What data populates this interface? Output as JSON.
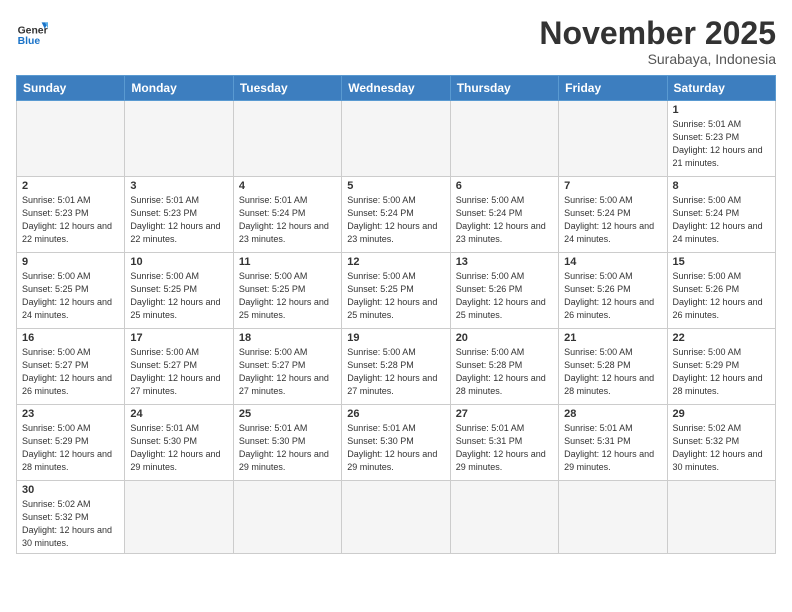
{
  "logo": {
    "text_general": "General",
    "text_blue": "Blue"
  },
  "header": {
    "month": "November 2025",
    "location": "Surabaya, Indonesia"
  },
  "weekdays": [
    "Sunday",
    "Monday",
    "Tuesday",
    "Wednesday",
    "Thursday",
    "Friday",
    "Saturday"
  ],
  "weeks": [
    [
      {
        "day": "",
        "empty": true
      },
      {
        "day": "",
        "empty": true
      },
      {
        "day": "",
        "empty": true
      },
      {
        "day": "",
        "empty": true
      },
      {
        "day": "",
        "empty": true
      },
      {
        "day": "",
        "empty": true
      },
      {
        "day": "1",
        "sunrise": "5:01 AM",
        "sunset": "5:23 PM",
        "daylight": "12 hours and 21 minutes."
      }
    ],
    [
      {
        "day": "2",
        "sunrise": "5:01 AM",
        "sunset": "5:23 PM",
        "daylight": "12 hours and 22 minutes."
      },
      {
        "day": "3",
        "sunrise": "5:01 AM",
        "sunset": "5:23 PM",
        "daylight": "12 hours and 22 minutes."
      },
      {
        "day": "4",
        "sunrise": "5:01 AM",
        "sunset": "5:24 PM",
        "daylight": "12 hours and 23 minutes."
      },
      {
        "day": "5",
        "sunrise": "5:00 AM",
        "sunset": "5:24 PM",
        "daylight": "12 hours and 23 minutes."
      },
      {
        "day": "6",
        "sunrise": "5:00 AM",
        "sunset": "5:24 PM",
        "daylight": "12 hours and 23 minutes."
      },
      {
        "day": "7",
        "sunrise": "5:00 AM",
        "sunset": "5:24 PM",
        "daylight": "12 hours and 24 minutes."
      },
      {
        "day": "8",
        "sunrise": "5:00 AM",
        "sunset": "5:24 PM",
        "daylight": "12 hours and 24 minutes."
      }
    ],
    [
      {
        "day": "9",
        "sunrise": "5:00 AM",
        "sunset": "5:25 PM",
        "daylight": "12 hours and 24 minutes."
      },
      {
        "day": "10",
        "sunrise": "5:00 AM",
        "sunset": "5:25 PM",
        "daylight": "12 hours and 25 minutes."
      },
      {
        "day": "11",
        "sunrise": "5:00 AM",
        "sunset": "5:25 PM",
        "daylight": "12 hours and 25 minutes."
      },
      {
        "day": "12",
        "sunrise": "5:00 AM",
        "sunset": "5:25 PM",
        "daylight": "12 hours and 25 minutes."
      },
      {
        "day": "13",
        "sunrise": "5:00 AM",
        "sunset": "5:26 PM",
        "daylight": "12 hours and 25 minutes."
      },
      {
        "day": "14",
        "sunrise": "5:00 AM",
        "sunset": "5:26 PM",
        "daylight": "12 hours and 26 minutes."
      },
      {
        "day": "15",
        "sunrise": "5:00 AM",
        "sunset": "5:26 PM",
        "daylight": "12 hours and 26 minutes."
      }
    ],
    [
      {
        "day": "16",
        "sunrise": "5:00 AM",
        "sunset": "5:27 PM",
        "daylight": "12 hours and 26 minutes."
      },
      {
        "day": "17",
        "sunrise": "5:00 AM",
        "sunset": "5:27 PM",
        "daylight": "12 hours and 27 minutes."
      },
      {
        "day": "18",
        "sunrise": "5:00 AM",
        "sunset": "5:27 PM",
        "daylight": "12 hours and 27 minutes."
      },
      {
        "day": "19",
        "sunrise": "5:00 AM",
        "sunset": "5:28 PM",
        "daylight": "12 hours and 27 minutes."
      },
      {
        "day": "20",
        "sunrise": "5:00 AM",
        "sunset": "5:28 PM",
        "daylight": "12 hours and 28 minutes."
      },
      {
        "day": "21",
        "sunrise": "5:00 AM",
        "sunset": "5:28 PM",
        "daylight": "12 hours and 28 minutes."
      },
      {
        "day": "22",
        "sunrise": "5:00 AM",
        "sunset": "5:29 PM",
        "daylight": "12 hours and 28 minutes."
      }
    ],
    [
      {
        "day": "23",
        "sunrise": "5:00 AM",
        "sunset": "5:29 PM",
        "daylight": "12 hours and 28 minutes."
      },
      {
        "day": "24",
        "sunrise": "5:01 AM",
        "sunset": "5:30 PM",
        "daylight": "12 hours and 29 minutes."
      },
      {
        "day": "25",
        "sunrise": "5:01 AM",
        "sunset": "5:30 PM",
        "daylight": "12 hours and 29 minutes."
      },
      {
        "day": "26",
        "sunrise": "5:01 AM",
        "sunset": "5:30 PM",
        "daylight": "12 hours and 29 minutes."
      },
      {
        "day": "27",
        "sunrise": "5:01 AM",
        "sunset": "5:31 PM",
        "daylight": "12 hours and 29 minutes."
      },
      {
        "day": "28",
        "sunrise": "5:01 AM",
        "sunset": "5:31 PM",
        "daylight": "12 hours and 29 minutes."
      },
      {
        "day": "29",
        "sunrise": "5:02 AM",
        "sunset": "5:32 PM",
        "daylight": "12 hours and 30 minutes."
      }
    ],
    [
      {
        "day": "30",
        "sunrise": "5:02 AM",
        "sunset": "5:32 PM",
        "daylight": "12 hours and 30 minutes."
      },
      {
        "day": "",
        "empty": true
      },
      {
        "day": "",
        "empty": true
      },
      {
        "day": "",
        "empty": true
      },
      {
        "day": "",
        "empty": true
      },
      {
        "day": "",
        "empty": true
      },
      {
        "day": "",
        "empty": true
      }
    ]
  ]
}
